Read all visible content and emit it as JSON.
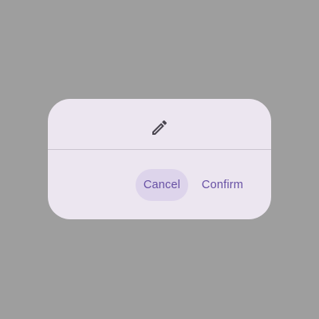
{
  "dialog": {
    "icon": "pencil-edit-icon",
    "actions": {
      "cancel_label": "Cancel",
      "confirm_label": "Confirm"
    }
  },
  "colors": {
    "scrim": "#9e9e9e",
    "surface": "#ece6f0",
    "divider": "#cac4d0",
    "icon": "#49454f",
    "button_text": "#6750a4",
    "cancel_highlight": "#ddd4eb"
  }
}
